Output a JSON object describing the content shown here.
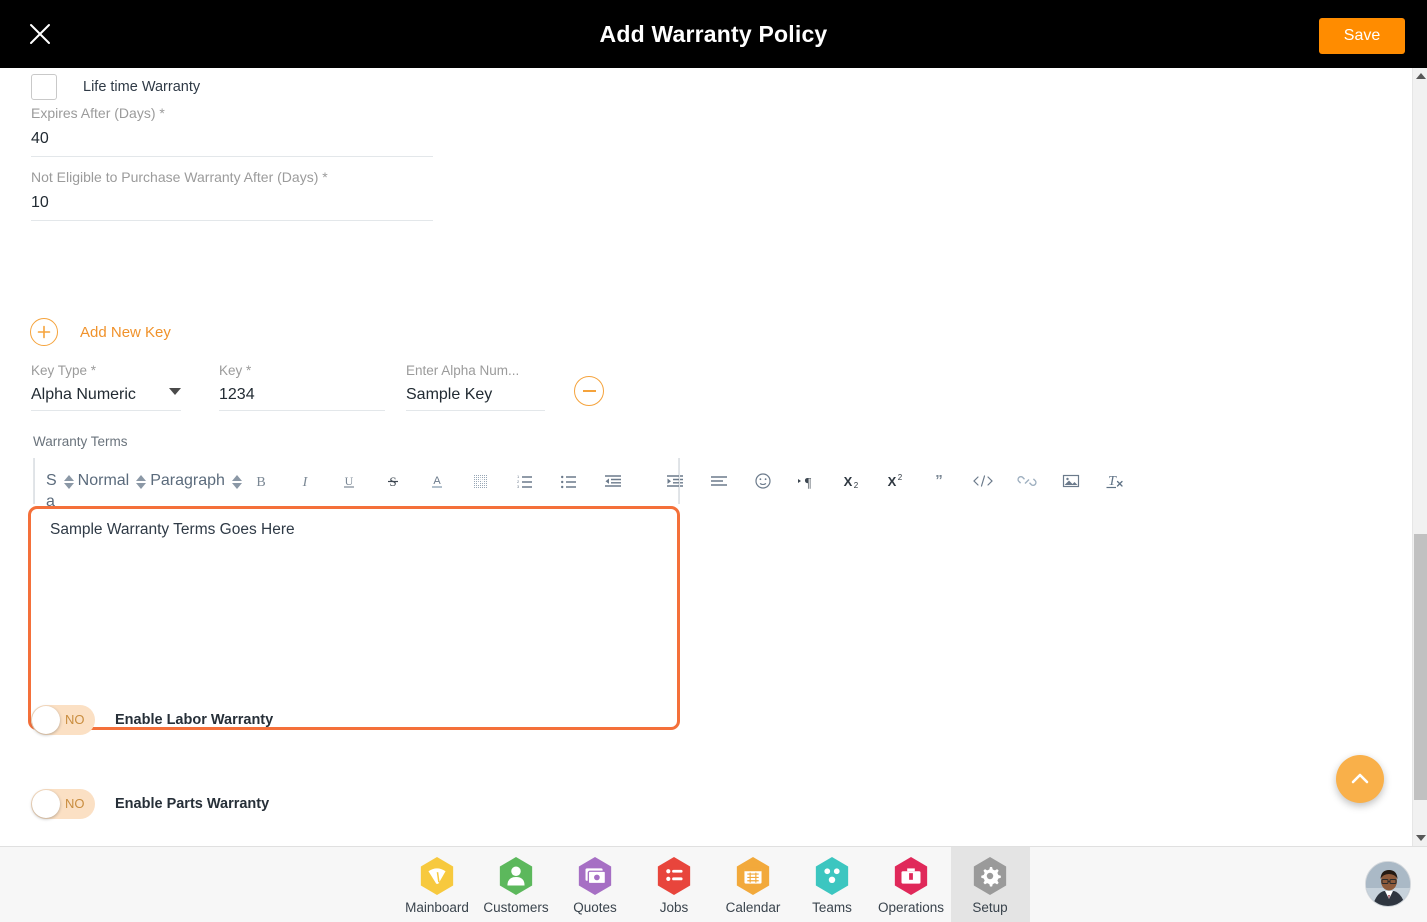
{
  "topbar": {
    "close_icon": "close-icon",
    "title": "Add Warranty Policy",
    "save_label": "Save",
    "background": "#000000",
    "save_color": "#ff8c00"
  },
  "form": {
    "lifetime_warranty": {
      "label": "Life time Warranty",
      "checked": false
    },
    "expires_after": {
      "label": "Expires After (Days) *",
      "value": "40"
    },
    "not_eligible_after": {
      "label": "Not Eligible to Purchase Warranty After (Days) *",
      "value": "10"
    },
    "add_new_key": {
      "label": "Add New Key",
      "icon": "plus-circle-icon",
      "color": "#f0922b"
    },
    "key_row": {
      "key_type": {
        "label": "Key Type *",
        "value": "Alpha Numeric",
        "options": [
          "Alpha Numeric"
        ]
      },
      "key": {
        "label": "Key *",
        "value": "1234"
      },
      "alpha": {
        "label": "Enter Alpha Num...",
        "value": "Sample Key"
      },
      "remove_icon": "minus-circle-icon"
    },
    "warranty_terms": {
      "label": "Warranty Terms",
      "content": "Sample Warranty Terms Goes Here",
      "highlight_color": "#f4703a",
      "toolbar": {
        "font": "Sans Serif",
        "size": "Normal",
        "block": "Paragraph",
        "buttons": [
          {
            "name": "bold-icon",
            "glyph": "B"
          },
          {
            "name": "italic-icon",
            "glyph": "I"
          },
          {
            "name": "underline-icon",
            "glyph": "U"
          },
          {
            "name": "strike-icon",
            "glyph": "S"
          },
          {
            "name": "text-color-icon",
            "glyph": "A"
          },
          {
            "name": "background-color-icon",
            "glyph": "A"
          },
          {
            "name": "ordered-list-icon",
            "glyph": ""
          },
          {
            "name": "bullet-list-icon",
            "glyph": ""
          },
          {
            "name": "outdent-icon",
            "glyph": ""
          },
          {
            "name": "indent-icon",
            "glyph": ""
          },
          {
            "name": "align-icon",
            "glyph": ""
          },
          {
            "name": "emoji-icon",
            "glyph": ""
          },
          {
            "name": "text-direction-icon",
            "glyph": ""
          },
          {
            "name": "subscript-icon",
            "glyph": "X2"
          },
          {
            "name": "superscript-icon",
            "glyph": "X2"
          },
          {
            "name": "blockquote-icon",
            "glyph": "”"
          },
          {
            "name": "code-block-icon",
            "glyph": "</>"
          },
          {
            "name": "link-icon",
            "glyph": ""
          },
          {
            "name": "image-icon",
            "glyph": ""
          },
          {
            "name": "clear-format-icon",
            "glyph": "Tx"
          }
        ]
      }
    },
    "toggles": [
      {
        "name": "enable-labor-warranty",
        "label": "Enable Labor Warranty",
        "state": "NO",
        "on": false
      },
      {
        "name": "enable-parts-warranty",
        "label": "Enable Parts Warranty",
        "state": "NO",
        "on": false
      }
    ]
  },
  "scroll_to_top": {
    "icon": "chevron-up-icon",
    "color": "#f9b04a"
  },
  "scrollbar": {
    "up_icon": "scroll-up-arrow-icon",
    "down_icon": "scroll-down-arrow-icon"
  },
  "bottom_nav": {
    "items": [
      {
        "label": "Mainboard",
        "icon": "mainboard-icon",
        "color": "#f6c council",
        "active": false
      },
      {
        "label": "Customers",
        "icon": "customers-icon",
        "active": false
      },
      {
        "label": "Quotes",
        "icon": "quotes-icon",
        "active": false
      },
      {
        "label": "Jobs",
        "icon": "jobs-icon",
        "active": false
      },
      {
        "label": "Calendar",
        "icon": "calendar-icon",
        "active": false
      },
      {
        "label": "Teams",
        "icon": "teams-icon",
        "active": false
      },
      {
        "label": "Operations",
        "icon": "operations-icon",
        "active": false
      },
      {
        "label": "Setup",
        "icon": "setup-gear-icon",
        "active": true
      }
    ],
    "colors": {
      "mainboard": "#f7c93e",
      "customers": "#5cb85c",
      "quotes": "#a66fc4",
      "jobs": "#e8453c",
      "calendar": "#f2a93b",
      "teams": "#3cc6c0",
      "operations": "#e0295a",
      "setup": "#9a9a9a"
    },
    "avatar": "user-avatar"
  }
}
